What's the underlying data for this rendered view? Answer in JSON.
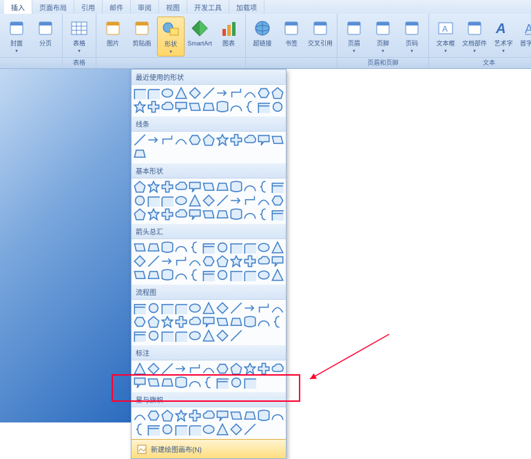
{
  "tabs": [
    "插入",
    "页面布局",
    "引用",
    "邮件",
    "审阅",
    "视图",
    "开发工具",
    "加载项"
  ],
  "active_tab": 0,
  "ribbon": {
    "groups": [
      {
        "label": "",
        "items": [
          {
            "name": "cover-page",
            "label": "封面",
            "arrow": true
          },
          {
            "name": "blank-page",
            "label": "分页",
            "arrow": false
          }
        ]
      },
      {
        "label": "表格",
        "items": [
          {
            "name": "table",
            "label": "表格",
            "arrow": true
          }
        ]
      },
      {
        "label": "",
        "items": [
          {
            "name": "picture",
            "label": "图片",
            "arrow": false
          },
          {
            "name": "clip-art",
            "label": "剪贴画",
            "arrow": false
          },
          {
            "name": "shapes",
            "label": "形状",
            "arrow": true,
            "active": true
          },
          {
            "name": "smartart",
            "label": "SmartArt",
            "arrow": false
          },
          {
            "name": "chart",
            "label": "图表",
            "arrow": false
          }
        ]
      },
      {
        "label": "",
        "items": [
          {
            "name": "hyperlink",
            "label": "超链接",
            "arrow": false
          },
          {
            "name": "bookmark",
            "label": "书签",
            "arrow": false
          },
          {
            "name": "cross-ref",
            "label": "交叉引用",
            "arrow": false
          }
        ]
      },
      {
        "label": "页眉和页脚",
        "items": [
          {
            "name": "header",
            "label": "页眉",
            "arrow": true
          },
          {
            "name": "footer",
            "label": "页脚",
            "arrow": true
          },
          {
            "name": "page-number",
            "label": "页码",
            "arrow": true
          }
        ]
      },
      {
        "label": "文本",
        "items": [
          {
            "name": "text-box",
            "label": "文本框",
            "arrow": true
          },
          {
            "name": "quick-parts",
            "label": "文档部件",
            "arrow": true
          },
          {
            "name": "wordart",
            "label": "艺术字",
            "arrow": true
          },
          {
            "name": "drop-cap",
            "label": "首字下沉",
            "arrow": true
          }
        ]
      }
    ]
  },
  "dropdown": {
    "sections": [
      {
        "title": "最近使用的形状",
        "count": 22,
        "rows": 2
      },
      {
        "title": "线条",
        "count": 12,
        "rows": 1
      },
      {
        "title": "基本形状",
        "count": 33,
        "rows": 3
      },
      {
        "title": "箭头总汇",
        "count": 33,
        "rows": 3
      },
      {
        "title": "流程图",
        "count": 30,
        "rows": 3
      },
      {
        "title": "标注",
        "count": 20,
        "rows": 2
      },
      {
        "title": "星与旗帜",
        "count": 20,
        "rows": 2
      }
    ],
    "footer_label": "新建绘图画布(N)"
  },
  "shape_glyphs": [
    "rect",
    "rrect",
    "ellipse",
    "tri",
    "diamond",
    "line",
    "arrow",
    "lconn",
    "curve",
    "hex",
    "pent",
    "star",
    "plus",
    "cloud",
    "callout",
    "para",
    "trap",
    "cylinder",
    "arc",
    "brace",
    "flow",
    "oval"
  ]
}
